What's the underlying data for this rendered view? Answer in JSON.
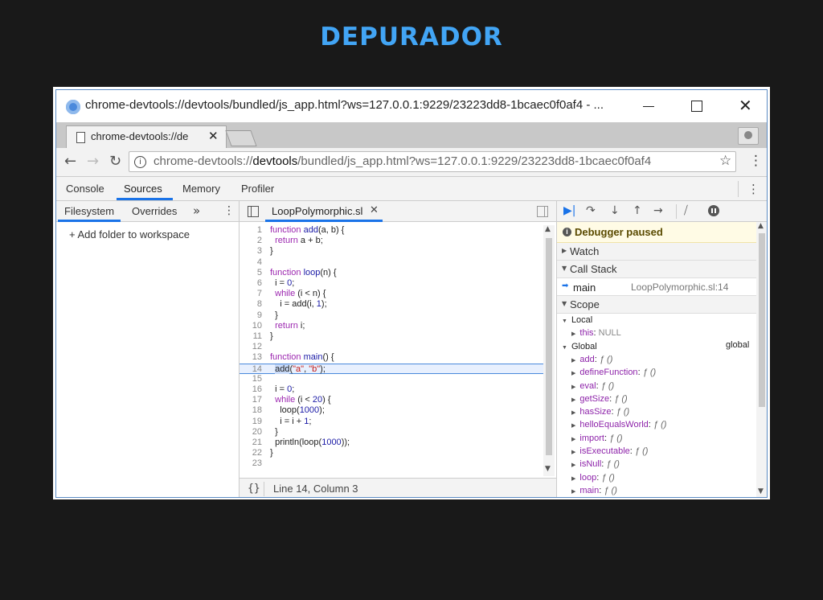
{
  "slide": {
    "title": "DEPURADOR"
  },
  "window": {
    "title": "chrome-devtools://devtools/bundled/js_app.html?ws=127.0.0.1:9229/23223dd8-1bcaec0f0af4 - ...",
    "minimize_glyph": "—",
    "close_glyph": "✕"
  },
  "browser_tab": {
    "label": "chrome-devtools://de",
    "close_glyph": "✕"
  },
  "address_bar": {
    "back_glyph": "←",
    "forward_glyph": "→",
    "reload_glyph": "↻",
    "url_prefix": "chrome-devtools://",
    "url_host": "devtools",
    "url_path": "/bundled/js_app.html?ws=127.0.0.1:9229/23223dd8-1bcaec0f0af4",
    "star_glyph": "☆",
    "menu_glyph": "⋮"
  },
  "devtools_tabs": [
    "Console",
    "Sources",
    "Memory",
    "Profiler"
  ],
  "devtools_active_tab": "Sources",
  "navigator": {
    "tabs": [
      "Filesystem",
      "Overrides"
    ],
    "more_glyph": "»",
    "kebab_glyph": "⋮",
    "add_folder": "+ Add folder to workspace"
  },
  "editor": {
    "file_tab": "LoopPolymorphic.sl",
    "file_tab_close": "✕",
    "highlight_line": 14,
    "lines": [
      [
        {
          "t": "function",
          "c": "k"
        },
        {
          "t": " "
        },
        {
          "t": "add",
          "c": "n"
        },
        {
          "t": "(a, b) {"
        }
      ],
      [
        {
          "t": "  "
        },
        {
          "t": "return",
          "c": "k"
        },
        {
          "t": " a + b;"
        }
      ],
      [
        {
          "t": "}"
        }
      ],
      [],
      [
        {
          "t": "function",
          "c": "k"
        },
        {
          "t": " "
        },
        {
          "t": "loop",
          "c": "n"
        },
        {
          "t": "(n) {"
        }
      ],
      [
        {
          "t": "  i = "
        },
        {
          "t": "0",
          "c": "n"
        },
        {
          "t": ";"
        }
      ],
      [
        {
          "t": "  "
        },
        {
          "t": "while",
          "c": "k"
        },
        {
          "t": " (i < n) {"
        }
      ],
      [
        {
          "t": "    i = add(i, "
        },
        {
          "t": "1",
          "c": "n"
        },
        {
          "t": ");"
        }
      ],
      [
        {
          "t": "  }"
        }
      ],
      [
        {
          "t": "  "
        },
        {
          "t": "return",
          "c": "k"
        },
        {
          "t": " i;"
        }
      ],
      [
        {
          "t": "}"
        }
      ],
      [],
      [
        {
          "t": "function",
          "c": "k"
        },
        {
          "t": " "
        },
        {
          "t": "main",
          "c": "n"
        },
        {
          "t": "() {"
        }
      ],
      [
        {
          "t": "  "
        },
        {
          "t": "add",
          "c": "sel"
        },
        {
          "t": "("
        },
        {
          "t": "\"a\"",
          "c": "s"
        },
        {
          "t": ", "
        },
        {
          "t": "\"b\"",
          "c": "s"
        },
        {
          "t": ");"
        }
      ],
      [],
      [
        {
          "t": "  i = "
        },
        {
          "t": "0",
          "c": "n"
        },
        {
          "t": ";"
        }
      ],
      [
        {
          "t": "  "
        },
        {
          "t": "while",
          "c": "k"
        },
        {
          "t": " (i < "
        },
        {
          "t": "20",
          "c": "n"
        },
        {
          "t": ") {"
        }
      ],
      [
        {
          "t": "    loop("
        },
        {
          "t": "1000",
          "c": "n"
        },
        {
          "t": ");"
        }
      ],
      [
        {
          "t": "    i = i + "
        },
        {
          "t": "1",
          "c": "n"
        },
        {
          "t": ";"
        }
      ],
      [
        {
          "t": "  }"
        }
      ],
      [
        {
          "t": "  println(loop("
        },
        {
          "t": "1000",
          "c": "n"
        },
        {
          "t": "));"
        }
      ],
      [
        {
          "t": "}"
        }
      ],
      []
    ],
    "status_braces": "{}",
    "status_position": "Line 14, Column 3"
  },
  "debugger": {
    "paused_text": "Debugger paused",
    "sections": {
      "watch": "Watch",
      "call_stack": "Call Stack",
      "scope": "Scope"
    },
    "call_stack": [
      {
        "fn": "main",
        "loc": "LoopPolymorphic.sl:14"
      }
    ],
    "scope": {
      "local_label": "Local",
      "local_items": [
        {
          "name": "this",
          "value": "NULL"
        }
      ],
      "global_label": "Global",
      "global_right": "global",
      "global_items": [
        {
          "name": "add",
          "value": "ƒ ()"
        },
        {
          "name": "defineFunction",
          "value": "ƒ ()"
        },
        {
          "name": "eval",
          "value": "ƒ ()"
        },
        {
          "name": "getSize",
          "value": "ƒ ()"
        },
        {
          "name": "hasSize",
          "value": "ƒ ()"
        },
        {
          "name": "helloEqualsWorld",
          "value": "ƒ ()"
        },
        {
          "name": "import",
          "value": "ƒ ()"
        },
        {
          "name": "isExecutable",
          "value": "ƒ ()"
        },
        {
          "name": "isNull",
          "value": "ƒ ()"
        },
        {
          "name": "loop",
          "value": "ƒ ()"
        },
        {
          "name": "main",
          "value": "ƒ ()"
        }
      ]
    }
  }
}
